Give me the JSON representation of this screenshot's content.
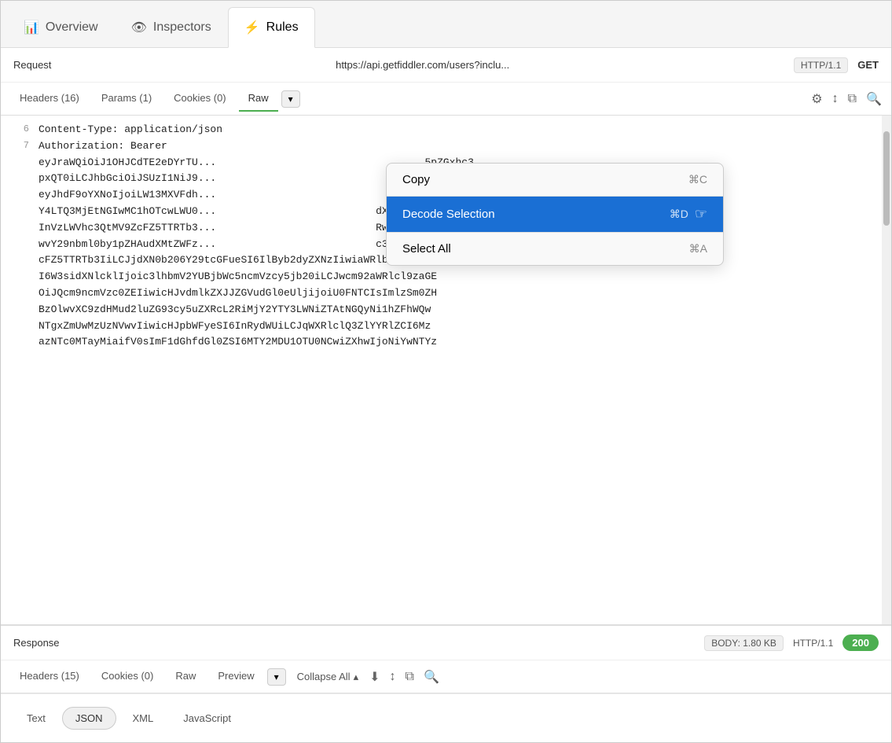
{
  "topTabs": [
    {
      "id": "overview",
      "label": "Overview",
      "icon": "📊",
      "active": false
    },
    {
      "id": "inspectors",
      "label": "Inspectors",
      "icon": "👁",
      "active": false
    },
    {
      "id": "rules",
      "label": "Rules",
      "icon": "⚡",
      "active": true
    }
  ],
  "requestBar": {
    "label": "Request",
    "url": "https://api.getfiddler.com/users?inclu...",
    "protocol": "HTTP/1.1",
    "method": "GET"
  },
  "requestSubTabs": [
    {
      "label": "Headers (16)",
      "active": false
    },
    {
      "label": "Params (1)",
      "active": false
    },
    {
      "label": "Cookies (0)",
      "active": false
    },
    {
      "label": "Raw",
      "active": true
    }
  ],
  "codeLines": [
    {
      "num": "6",
      "content": "Content-Type: application/json"
    },
    {
      "num": "7",
      "content": "Authorization: Bearer"
    },
    {
      "num": "",
      "content": "eyJraWQiOiJ1OHJCdTE2eDYrTU...                                      5pZGxhc3"
    },
    {
      "num": "",
      "content": "pxQT0iLCJhbGciOiJSUzI1NiJ9..."
    },
    {
      "num": "",
      "content": "eyJhdF9oYXNoIjoiLW13MXVFdh...                                  hiNTU3Y2"
    },
    {
      "num": "",
      "content": "Y4LTQ3MjEtNGIwMC1hOTcwLWU0...                              dXBzIjpb"
    },
    {
      "num": "",
      "content": "InVzLWVhc3QtMV9ZcFZ5TTRTb3...                              RwczpcL1"
    },
    {
      "num": "",
      "content": "wvY29nbml0by1pZHAudXMtZWFz...                              c3QtMV9Z"
    },
    {
      "num": "",
      "content": "cFZ5TTRTb3IiLCJjdXN0b206Y29tcGFueSI6IlByb2dyZXNzIiwiaWRlbnRpdHkiOm"
    },
    {
      "num": "",
      "content": "I6W3sidXNlcklIjoic3lhbmV2YUBjbWc5ncmVzcy5jb20iLCJwcm92aWRlcl9zaGE"
    },
    {
      "num": "",
      "content": "OiJQcm9ncmVzc0ZEIiwicHJvdmlkZXJJZGVudGl0eUljijoiU0FNTCIsImlzSm0ZH"
    },
    {
      "num": "",
      "content": "BzOlwvXC9zdHMud2luZG93cy5uZXRcL2RiMjY2YTY3LWNiZTAtNGQyNi1hZFhWQw"
    },
    {
      "num": "",
      "content": "NTgxZmUwMzUzNVwvIiwicHJpbWFyeSI6InRydWUiLCJqWXRlclQ3ZlYYRlZCI6Mz"
    },
    {
      "num": "",
      "content": "azNTc0MTayMiaifV0sImF1dGhfdGl0ZSI6MTY2MDU1OTU0NCwiZXhwIjoNiYwNTYz"
    }
  ],
  "contextMenu": {
    "items": [
      {
        "label": "Copy",
        "shortcut": "⌘C",
        "highlighted": false,
        "id": "copy"
      },
      {
        "label": "Decode Selection",
        "shortcut": "⌘D",
        "highlighted": true,
        "id": "decode-selection"
      },
      {
        "label": "Select All",
        "shortcut": "⌘A",
        "highlighted": false,
        "id": "select-all"
      }
    ]
  },
  "responseBar": {
    "label": "Response",
    "bodySize": "BODY: 1.80 KB",
    "protocol": "HTTP/1.1",
    "statusCode": "200"
  },
  "responseSubTabs": [
    {
      "label": "Headers (15)",
      "active": false
    },
    {
      "label": "Cookies (0)",
      "active": false
    },
    {
      "label": "Raw",
      "active": false
    },
    {
      "label": "Preview",
      "active": false
    }
  ],
  "collapseAll": "Collapse All",
  "formatTabs": [
    {
      "label": "Text",
      "active": false
    },
    {
      "label": "JSON",
      "active": true
    },
    {
      "label": "XML",
      "active": false
    },
    {
      "label": "JavaScript",
      "active": false
    }
  ],
  "icons": {
    "filter": "☰",
    "sort": "↕",
    "copy": "⧉",
    "search": "🔍",
    "download": "⬇",
    "chevronDown": "▾",
    "chevronUp": "▴"
  }
}
